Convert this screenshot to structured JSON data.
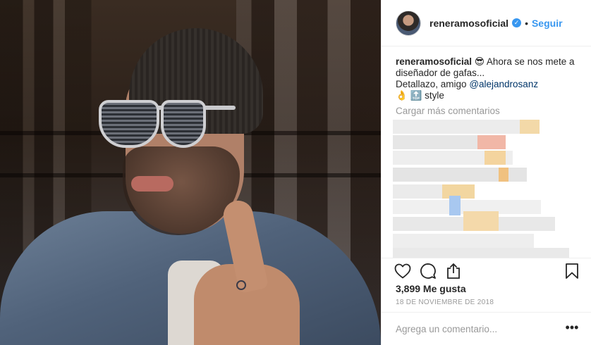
{
  "post": {
    "username": "reneramosoficial",
    "follow_label": "Seguir",
    "separator": "•",
    "caption": {
      "username": "reneramosoficial",
      "emoji": "😎",
      "line1": "Ahora se nos mete a diseñador de gafas...",
      "line2_prefix": "Detallazo, amigo ",
      "mention": "@alejandrosanz",
      "line3_emojis": "👌 🔝",
      "line3_text": "style"
    },
    "load_more_label": "Cargar más comentarios",
    "likes": "3,899 Me gusta",
    "date": "18 DE NOVIEMBRE DE 2018",
    "comment_placeholder": "Agrega un comentario...",
    "more_label": "•••"
  },
  "icons": {
    "verified": "verified-badge-icon",
    "like": "heart-icon",
    "comment": "comment-bubble-icon",
    "share": "share-icon",
    "save": "bookmark-icon"
  },
  "colors": {
    "accent": "#3897f0",
    "mention": "#003569",
    "muted": "#999999",
    "text": "#262626"
  }
}
